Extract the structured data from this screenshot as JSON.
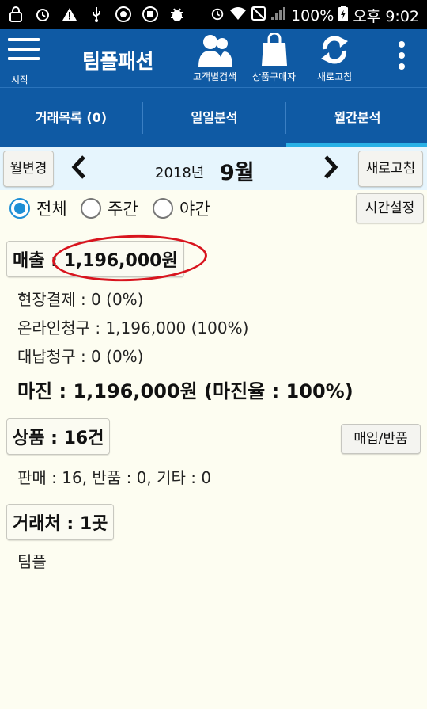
{
  "status_bar": {
    "battery": "100%",
    "time": "오후 9:02"
  },
  "app_bar": {
    "menu_label": "시작",
    "title": "팀플패션",
    "actions": [
      {
        "label": "고객별검색",
        "icon": "people-icon"
      },
      {
        "label": "상품구매자",
        "icon": "shopping-bag-icon"
      },
      {
        "label": "새로고침",
        "icon": "refresh-icon"
      }
    ]
  },
  "tabs": [
    {
      "label": "거래목록 (0)",
      "active": false
    },
    {
      "label": "일일분석",
      "active": false
    },
    {
      "label": "월간분석",
      "active": true
    }
  ],
  "month_nav": {
    "change_label": "월변경",
    "year": "2018년",
    "month": "9월",
    "refresh_label": "새로고침"
  },
  "filter": {
    "options": [
      "전체",
      "주간",
      "야간"
    ],
    "selected": "전체",
    "time_setting_label": "시간설정"
  },
  "sales": {
    "label": "매출 : 1,196,000원",
    "onsite": "현장결제 : 0 (0%)",
    "online": "온라인청구 : 1,196,000 (100%)",
    "deferred": "대납청구 : 0 (0%)",
    "margin": "마진 : 1,196,000원 (마진율 : 100%)"
  },
  "products": {
    "label": "상품 : 16건",
    "purchase_return_label": "매입/반품",
    "detail": "판매 : 16, 반품 : 0, 기타 : 0"
  },
  "clients": {
    "label": "거래처 : 1곳",
    "detail": "팀플"
  },
  "colors": {
    "primary": "#0f5aa4",
    "tab_indicator": "#29b1e6",
    "background": "#fdfdf1",
    "highlight_circle": "#d8141e",
    "radio_selected": "#1e8fd6"
  }
}
